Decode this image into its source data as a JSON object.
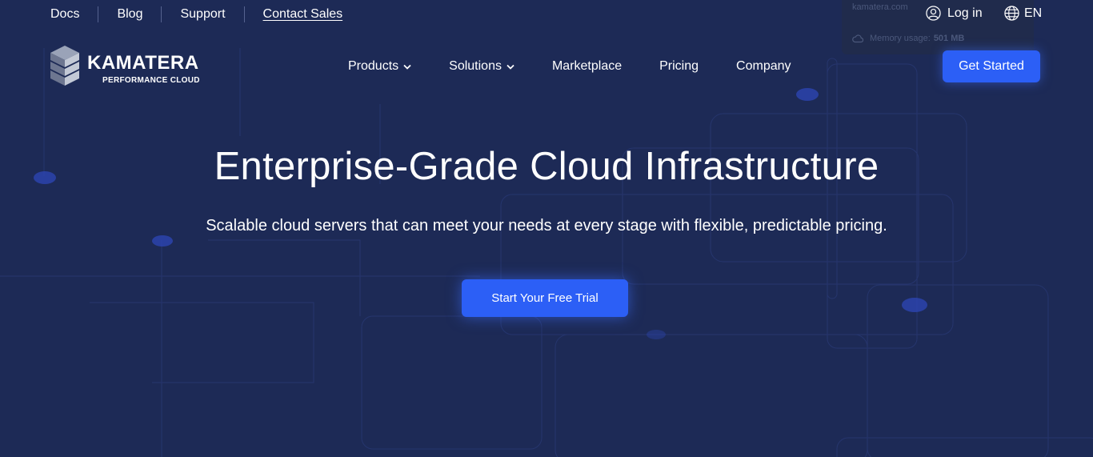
{
  "topbar": {
    "links": [
      {
        "label": "Docs"
      },
      {
        "label": "Blog"
      },
      {
        "label": "Support"
      },
      {
        "label": "Contact Sales"
      }
    ],
    "memory_tooltip": {
      "domain": "kamatera.com",
      "label": "Memory usage:",
      "value": "501 MB"
    },
    "login_label": "Log in",
    "language": "EN"
  },
  "header": {
    "logo_name": "KAMATERA",
    "logo_tagline": "PERFORMANCE CLOUD",
    "nav": [
      {
        "label": "Products",
        "has_dropdown": true
      },
      {
        "label": "Solutions",
        "has_dropdown": true
      },
      {
        "label": "Marketplace",
        "has_dropdown": false
      },
      {
        "label": "Pricing",
        "has_dropdown": false
      },
      {
        "label": "Company",
        "has_dropdown": false
      }
    ],
    "get_started_label": "Get Started"
  },
  "hero": {
    "title": "Enterprise-Grade Cloud Infrastructure",
    "subtitle": "Scalable cloud servers that can meet your needs at every stage with flexible, predictable pricing.",
    "cta_label": "Start Your Free Trial"
  },
  "colors": {
    "background": "#1d2a56",
    "accent": "#2c5ff6",
    "text": "#ffffff"
  },
  "icons": {
    "login": "user-circle-icon",
    "language": "globe-icon",
    "memory": "cloud-icon",
    "dropdown": "chevron-down-icon"
  }
}
